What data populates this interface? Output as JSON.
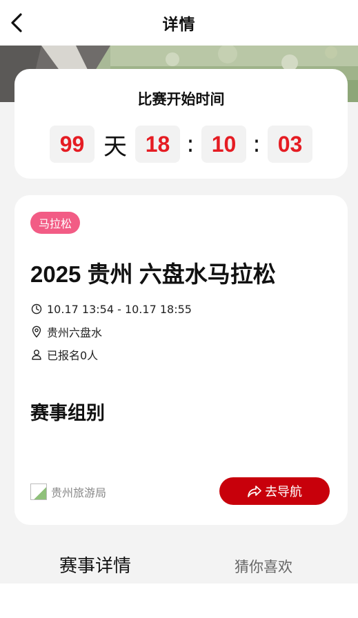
{
  "navbar": {
    "title": "详情"
  },
  "countdown": {
    "title": "比赛开始时间",
    "days": "99",
    "days_unit": "天",
    "hours": "18",
    "minutes": "10",
    "seconds": "03",
    "separator": ":"
  },
  "event": {
    "tag": "马拉松",
    "title": "2025 贵州 六盘水马拉松",
    "time": "10.17 13:54 - 10.17 18:55",
    "location": "贵州六盘水",
    "registered": "已报名0人",
    "section_title": "赛事组别",
    "organizer": "贵州旅游局",
    "navigate_label": "去导航"
  },
  "tabs": [
    {
      "label": "赛事详情",
      "active": true
    },
    {
      "label": "猜你喜欢",
      "active": false
    }
  ],
  "colors": {
    "accent_red": "#e51c23",
    "button_red": "#c8000b",
    "tag_pink": "#f25c85"
  },
  "icons": {
    "back": "chevron-left-icon",
    "clock": "clock-icon",
    "location": "location-pin-icon",
    "person": "person-icon",
    "share": "share-arrow-icon"
  }
}
